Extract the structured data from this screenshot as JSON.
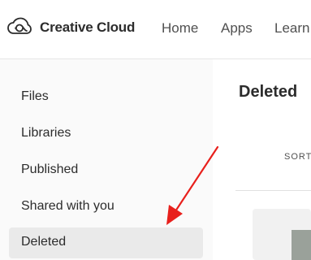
{
  "header": {
    "brand": "Creative Cloud",
    "logo_icon": "creative-cloud-logo-icon",
    "nav": [
      "Home",
      "Apps",
      "Learn"
    ]
  },
  "sidebar": {
    "items": [
      {
        "label": "Files"
      },
      {
        "label": "Libraries"
      },
      {
        "label": "Published"
      },
      {
        "label": "Shared with you"
      },
      {
        "label": "Deleted",
        "active": true
      }
    ]
  },
  "main": {
    "title": "Deleted",
    "sort_label": "SORT"
  },
  "annotation": {
    "arrow_color": "#e8201c"
  },
  "colors": {
    "accent_bg": "#eaeaea",
    "text": "#2c2c2c"
  }
}
